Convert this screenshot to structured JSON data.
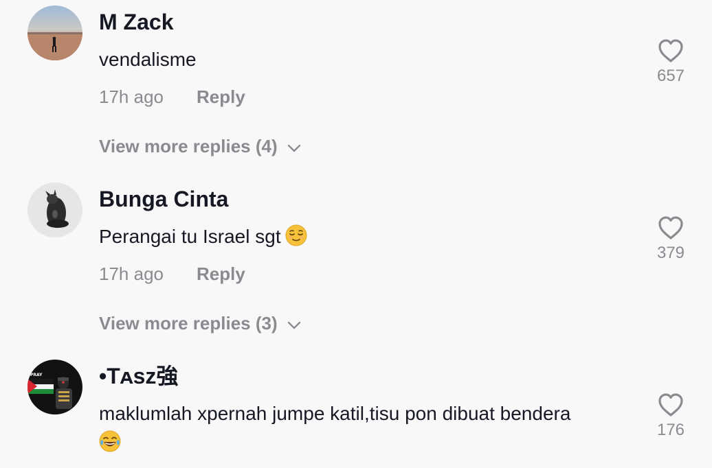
{
  "comments": [
    {
      "username": "M Zack",
      "text": "vendalisme",
      "time": "17h ago",
      "reply_label": "Reply",
      "likes": "657",
      "view_more": "View more replies (4)",
      "emoji": ""
    },
    {
      "username": "Bunga Cinta",
      "text": "Perangai tu Israel sgt",
      "time": "17h ago",
      "reply_label": "Reply",
      "likes": "379",
      "view_more": "View more replies (3)",
      "emoji": "relieved-face"
    },
    {
      "username": "•Tᴀsᴢ強",
      "text": "maklumlah xpernah jumpe katil,tisu pon dibuat bendera",
      "likes": "176",
      "emoji": "tears-of-joy-face",
      "avatar_text": "PRAY FOR PALESTINE"
    }
  ],
  "colors": {
    "background": "#f8f8f8",
    "primary_text": "#161823",
    "secondary_text": "#8a8b91",
    "emoji_yellow": "#f7c23a"
  },
  "icons": {
    "like": "heart-outline-icon",
    "expand": "chevron-down-icon"
  }
}
